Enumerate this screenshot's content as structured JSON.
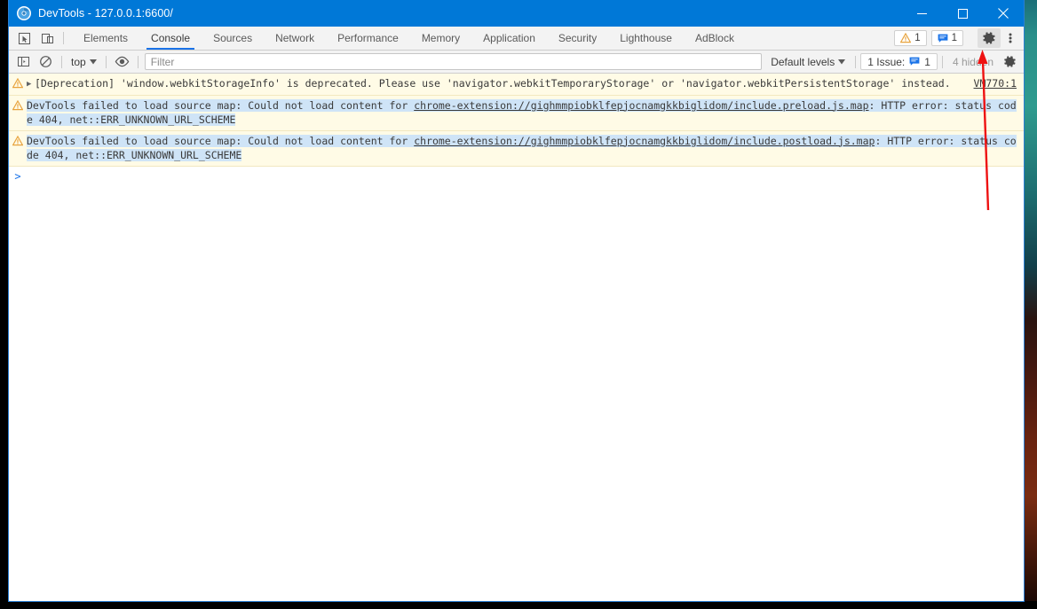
{
  "window": {
    "title": "DevTools - 127.0.0.1:6600/",
    "app_icon": "devtools-logo-icon",
    "controls": {
      "minimize": "minimize-icon",
      "maximize": "maximize-icon",
      "close": "close-icon"
    },
    "titlebar_color": "#0078d7",
    "border_color": "#2a7fd4"
  },
  "tabbar": {
    "left_icons": [
      {
        "name": "inspect-element-icon"
      },
      {
        "name": "device-toolbar-icon"
      }
    ],
    "tabs": [
      {
        "label": "Elements",
        "active": false
      },
      {
        "label": "Console",
        "active": true
      },
      {
        "label": "Sources",
        "active": false
      },
      {
        "label": "Network",
        "active": false
      },
      {
        "label": "Performance",
        "active": false
      },
      {
        "label": "Memory",
        "active": false
      },
      {
        "label": "Application",
        "active": false
      },
      {
        "label": "Security",
        "active": false
      },
      {
        "label": "Lighthouse",
        "active": false
      },
      {
        "label": "AdBlock",
        "active": false
      }
    ],
    "active_tab_underline_color": "#1a73e8",
    "warning_badge": {
      "icon": "warning-triangle-icon",
      "count": "1",
      "color": "#e8a33d"
    },
    "message_badge": {
      "icon": "message-bubble-icon",
      "count": "1",
      "color": "#1a73e8"
    },
    "settings_icon": "gear-icon",
    "more_icon": "kebab-menu-icon"
  },
  "console_toolbar": {
    "sidebar_toggle_icon": "console-sidebar-icon",
    "clear_console_icon": "clear-console-icon",
    "context": {
      "label": "top",
      "chevron": "chevron-down-icon"
    },
    "live_expression_icon": "eye-icon",
    "filter": {
      "value": "",
      "placeholder": "Filter"
    },
    "levels": {
      "label": "Default levels",
      "chevron": "chevron-down-icon"
    },
    "issues": {
      "label": "1 Issue:",
      "icon": "message-bubble-icon",
      "count": "1"
    },
    "hidden_count": "4 hidden",
    "settings_icon": "gear-icon"
  },
  "console": {
    "messages": [
      {
        "icon": "warning-triangle-icon",
        "expandable": true,
        "expand_glyph": "▶",
        "selected": false,
        "parts": [
          {
            "text": "[Deprecation] 'window.webkitStorageInfo' is deprecated. Please use 'navigator.webkitTemporaryStorage' or 'navigator.webkitPersistentStorage' instead.",
            "link": false
          }
        ],
        "source": "VM770:1"
      },
      {
        "icon": "warning-triangle-icon",
        "expandable": false,
        "selected": true,
        "parts": [
          {
            "text": "DevTools failed to load source map: Could not load content for ",
            "link": false
          },
          {
            "text": "chrome-extension://gighmmpiobklfepjocnamgkkbiglidom/include.preload.js.map",
            "link": true
          },
          {
            "text": ": HTTP error: status code 404, net::ERR_UNKNOWN_URL_SCHEME",
            "link": false
          }
        ],
        "source": ""
      },
      {
        "icon": "warning-triangle-icon",
        "expandable": false,
        "selected": true,
        "parts": [
          {
            "text": "DevTools failed to load source map: Could not load content for ",
            "link": false
          },
          {
            "text": "chrome-extension://gighmmpiobklfepjocnamgkkbiglidom/include.postload.js.map",
            "link": true
          },
          {
            "text": ": HTTP error: status code 404, net::ERR_UNKNOWN_URL_SCHEME",
            "link": false
          }
        ],
        "source": ""
      }
    ],
    "prompt_caret": ">",
    "warning_background": "#fffbe6",
    "selection_highlight": "#cfe4f7"
  },
  "annotation": {
    "arrow": {
      "name": "red-annotation-arrow",
      "color": "#ee1111",
      "points_to": "gear-icon"
    }
  }
}
